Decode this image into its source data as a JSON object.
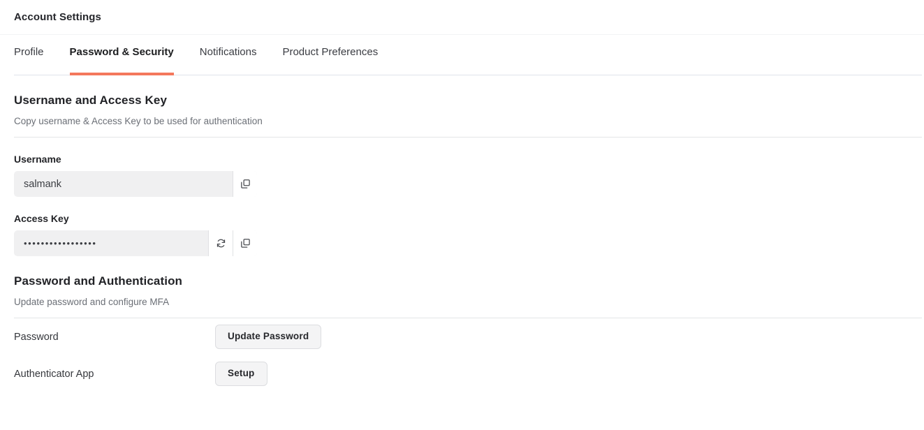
{
  "header": {
    "title": "Account Settings"
  },
  "tabs": [
    {
      "label": "Profile",
      "active": false
    },
    {
      "label": "Password & Security",
      "active": true
    },
    {
      "label": "Notifications",
      "active": false
    },
    {
      "label": "Product Preferences",
      "active": false
    }
  ],
  "sections": {
    "credentials": {
      "title": "Username and Access Key",
      "subtitle": "Copy username & Access Key to be used for authentication",
      "username": {
        "label": "Username",
        "value": "salmank",
        "copy_icon": "copy-icon"
      },
      "access_key": {
        "label": "Access Key",
        "value": "•••••••••••••••••",
        "regenerate_icon": "refresh-icon",
        "copy_icon": "copy-icon"
      }
    },
    "authentication": {
      "title": "Password and Authentication",
      "subtitle": "Update password and configure MFA",
      "rows": [
        {
          "label": "Password",
          "button": "Update Password"
        },
        {
          "label": "Authenticator App",
          "button": "Setup"
        }
      ]
    }
  },
  "colors": {
    "accent": "#f4785c",
    "text": "#2c2c2c",
    "muted": "#6b6f76",
    "field_bg": "#f0f0f1",
    "button_bg": "#f4f4f5",
    "rule": "#e4e5e7"
  }
}
